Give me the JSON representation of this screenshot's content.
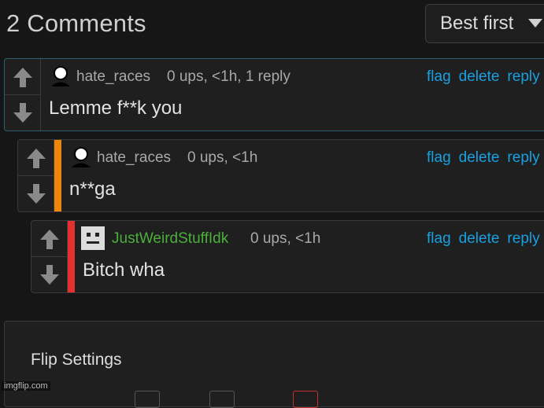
{
  "header": {
    "title": "2 Comments"
  },
  "sort": {
    "selected": "Best first"
  },
  "comments": [
    {
      "username": "hate_races",
      "username_color": "#a9a9a9",
      "meta": "0 ups, <1h, 1 reply",
      "body": "Lemme f**k you",
      "stripe_color": "",
      "avatar": "person-avatar"
    },
    {
      "username": "hate_races",
      "username_color": "#a9a9a9",
      "meta": "0 ups, <1h",
      "body": "n**ga",
      "stripe_color": "#f0850c",
      "avatar": "person-avatar"
    },
    {
      "username": "JustWeirdStuffIdk",
      "username_color": "#4caf3c",
      "meta": "0 ups, <1h",
      "body": "Bitch wha",
      "stripe_color": "#e53030",
      "avatar": "robot-avatar"
    }
  ],
  "actions": {
    "flag": "flag",
    "delete": "delete",
    "reply": "reply"
  },
  "settings": {
    "title": "Flip Settings"
  },
  "watermark": "imgflip.com",
  "colors": {
    "background": "#161616",
    "panel": "#1f1f1f",
    "link": "#19a0e0",
    "border": "#3a3a3a"
  }
}
